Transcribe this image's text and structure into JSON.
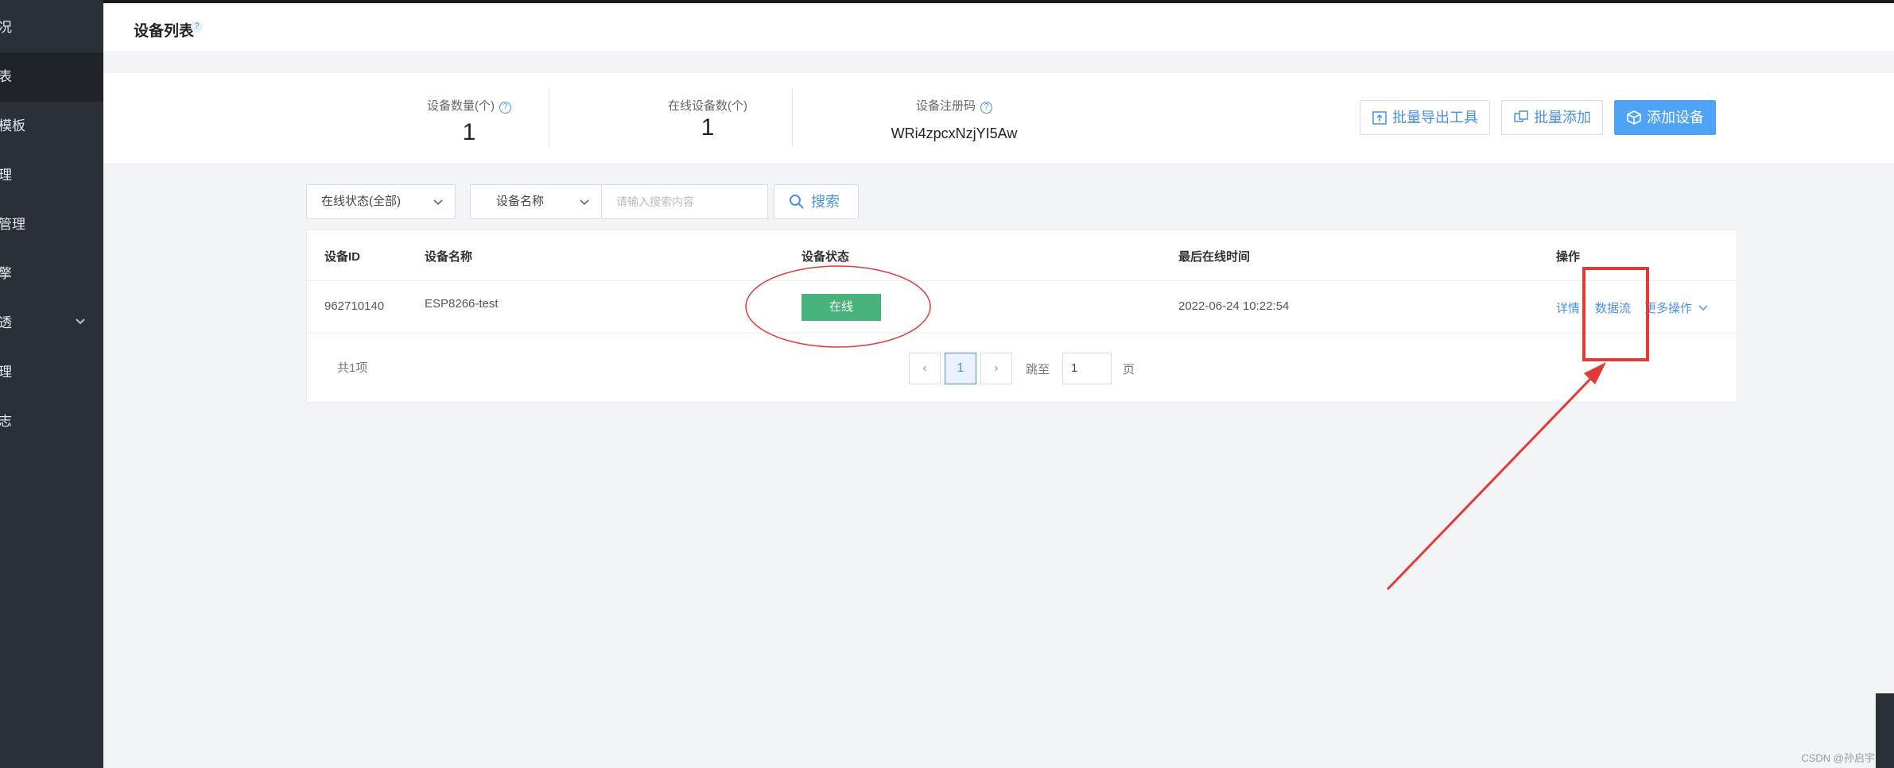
{
  "sidebar": {
    "items": [
      {
        "label": "况"
      },
      {
        "label": "表"
      },
      {
        "label": "模板"
      },
      {
        "label": "理"
      },
      {
        "label": "管理"
      },
      {
        "label": "擎"
      },
      {
        "label": "透"
      },
      {
        "label": "理"
      },
      {
        "label": "志"
      }
    ]
  },
  "header": {
    "title": "设备列表",
    "help": "?"
  },
  "stats": {
    "device_count_label": "设备数量(个)",
    "device_count": "1",
    "online_count_label": "在线设备数(个)",
    "online_count": "1",
    "reg_code_label": "设备注册码",
    "reg_code": "WRi4zpcxNzjYI5Aw",
    "q": "?"
  },
  "toolbar": {
    "export_label": "批量导出工具",
    "batch_add_label": "批量添加",
    "add_device_label": "添加设备"
  },
  "filters": {
    "status_select": "在线状态(全部)",
    "field_select": "设备名称",
    "search_placeholder": "请输入搜索内容",
    "search_label": "搜索"
  },
  "table": {
    "headers": [
      "设备ID",
      "设备名称",
      "设备状态",
      "最后在线时间",
      "操作"
    ],
    "rows": [
      {
        "id": "962710140",
        "name": "ESP8266-test",
        "status": "在线",
        "last_online": "2022-06-24 10:22:54",
        "actions": {
          "detail": "详情",
          "datastream": "数据流",
          "more": "更多操作"
        }
      }
    ]
  },
  "pagination": {
    "total": "共1项",
    "current_page": "1",
    "goto_label": "跳至",
    "goto_value": "1",
    "page_suffix": "页"
  },
  "watermark": "CSDN @孙启宇",
  "colors": {
    "sidebar": "#2b2f36",
    "accent": "#4fa3f7",
    "status_online": "#48b37a",
    "annotation": "#e53935"
  }
}
